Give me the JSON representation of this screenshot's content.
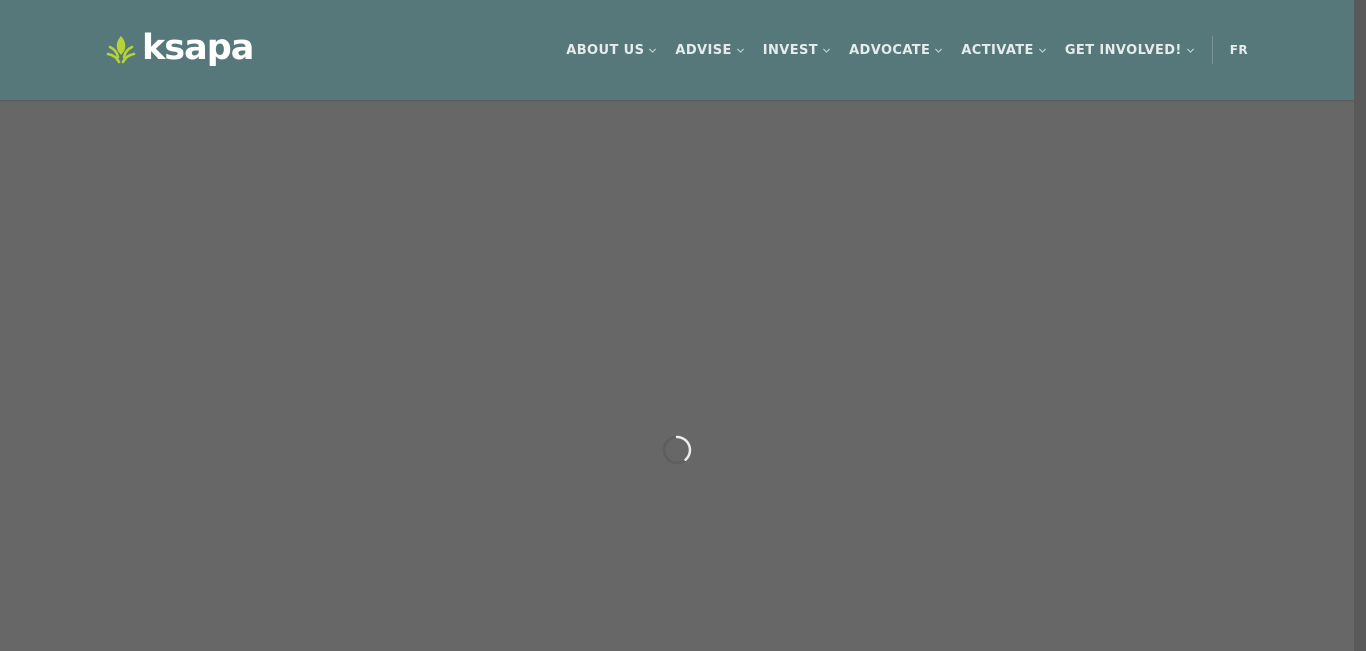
{
  "brand": {
    "name": "ksapa",
    "logo_icon": "ksapa-leaf-icon",
    "accent_color": "#b5d334",
    "header_color": "#56787a"
  },
  "nav": {
    "items": [
      {
        "label": "ABOUT US",
        "icon": "chevron-down-icon"
      },
      {
        "label": "ADVISE",
        "icon": "chevron-down-icon"
      },
      {
        "label": "INVEST",
        "icon": "chevron-down-icon"
      },
      {
        "label": "ADVOCATE",
        "icon": "chevron-down-icon"
      },
      {
        "label": "ACTIVATE",
        "icon": "chevron-down-icon"
      },
      {
        "label": "GET INVOLVED!",
        "icon": "chevron-down-icon"
      }
    ],
    "language": "FR"
  },
  "content": {
    "state": "loading",
    "loader_icon": "loading-spinner-icon",
    "overlay_color": "#676767"
  }
}
